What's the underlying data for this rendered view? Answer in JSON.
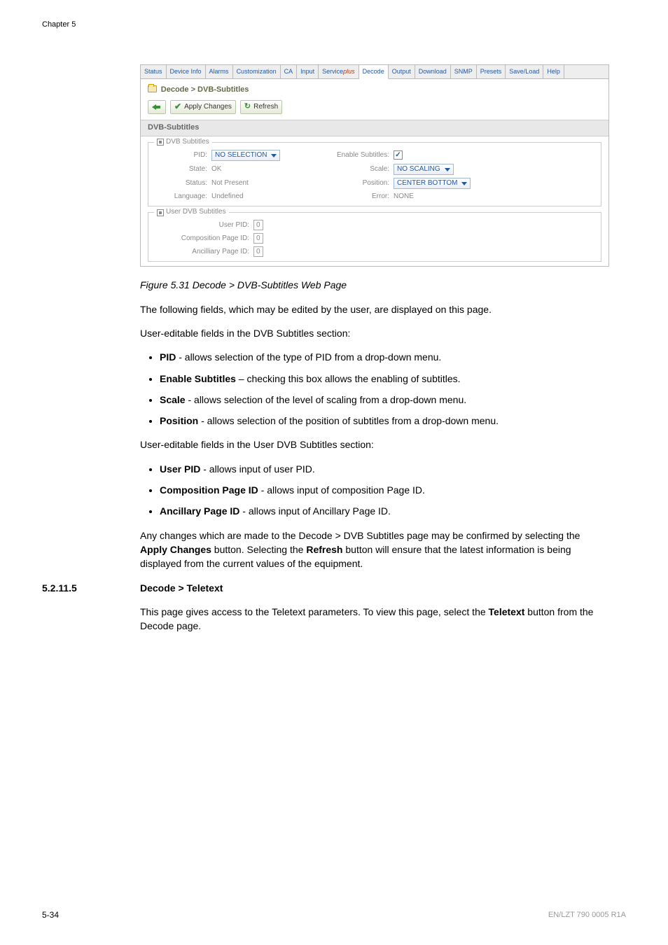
{
  "chapter": "Chapter 5",
  "tabs": {
    "status": "Status",
    "device_info": "Device Info",
    "alarms": "Alarms",
    "customization": "Customization",
    "ca": "CA",
    "input": "Input",
    "service_prefix": "Service",
    "service_suffix": "plus",
    "decode": "Decode",
    "output": "Output",
    "download": "Download",
    "snmp": "SNMP",
    "presets": "Presets",
    "save_load": "Save/Load",
    "help": "Help"
  },
  "breadcrumb": "Decode > DVB-Subtitles",
  "toolbar": {
    "apply": "Apply Changes",
    "refresh": "Refresh"
  },
  "section_header": "DVB-Subtitles",
  "fs1": {
    "legend": "DVB Subtitles",
    "pid_lbl": "PID:",
    "pid": "NO SELECTION",
    "enable_lbl": "Enable Subtitles:",
    "enable_checked": "✓",
    "state_lbl": "State:",
    "state": "OK",
    "scale_lbl": "Scale:",
    "scale": "NO SCALING",
    "status_lbl": "Status:",
    "status": "Not Present",
    "position_lbl": "Position:",
    "position": "CENTER BOTTOM",
    "language_lbl": "Language:",
    "language": "Undefined",
    "error_lbl": "Error:",
    "error": "NONE"
  },
  "fs2": {
    "legend": "User DVB Subtitles",
    "user_pid_lbl": "User PID:",
    "user_pid": "0",
    "comp_lbl": "Composition Page ID:",
    "comp": "0",
    "anc_lbl": "Ancilliary Page ID:",
    "anc": "0"
  },
  "caption": "Figure 5.31 Decode > DVB-Subtitles Web Page",
  "p_intro": "The following fields, which may be edited by the user, are displayed on this page.",
  "p_user_edit1": "User-editable fields in the DVB Subtitles section:",
  "b1": {
    "b": "PID",
    "t": " - allows selection of the type of PID from a drop-down menu."
  },
  "b2": {
    "b": "Enable Subtitles",
    "t": " – checking this box allows the enabling of subtitles."
  },
  "b3": {
    "b": "Scale",
    "t": " - allows selection of the level of scaling from a drop-down menu."
  },
  "b4": {
    "b": "Position",
    "t": " - allows selection of the position of subtitles from a drop-down menu."
  },
  "p_user_edit2": "User-editable fields in the User DVB Subtitles section:",
  "b5": {
    "b": "User PID",
    "t": " - allows input of user PID."
  },
  "b6": {
    "b": "Composition Page ID",
    "t": " - allows input of composition Page ID."
  },
  "b7": {
    "b": "Ancillary Page ID",
    "t": " - allows input of Ancillary Page ID."
  },
  "p_changes_a": "Any changes which are made to the Decode > DVB Subtitles page may be confirmed by selecting the ",
  "p_changes_b1": "Apply Changes",
  "p_changes_c": " button. Selecting the ",
  "p_changes_b2": "Refresh",
  "p_changes_d": " button will ensure that the latest information is being displayed from the current values of the equipment.",
  "sect_num": "5.2.11.5",
  "sect_title": "Decode > Teletext",
  "p_teletext_a": "This page gives access to the Teletext parameters. To view this page, select the ",
  "p_teletext_b": "Teletext",
  "p_teletext_c": " button from the Decode page.",
  "footer_left": "5-34",
  "footer_right": "EN/LZT 790 0005 R1A"
}
